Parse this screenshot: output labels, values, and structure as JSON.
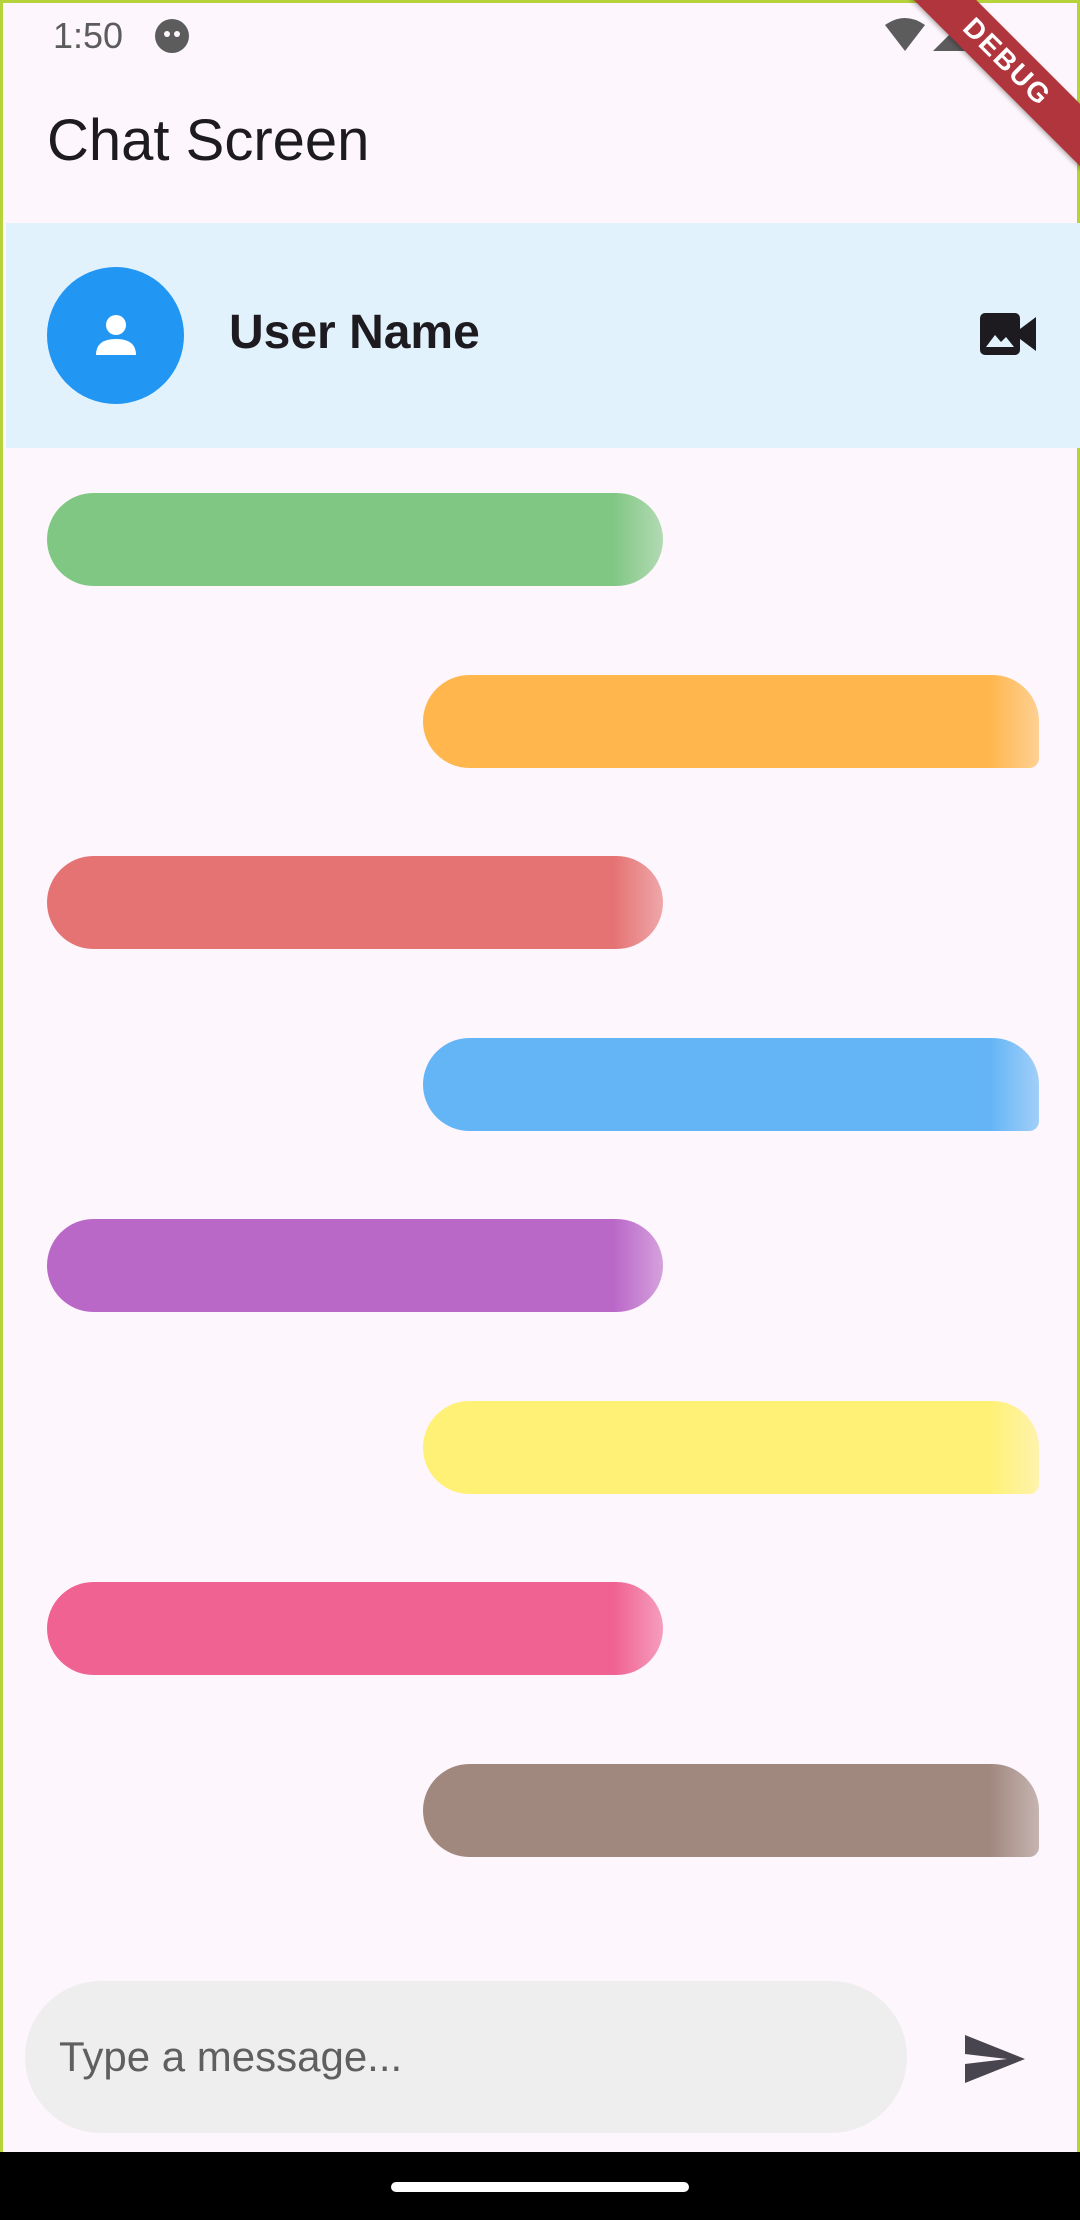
{
  "status_bar": {
    "time": "1:50"
  },
  "debug_banner": "DEBUG",
  "app_bar": {
    "title": "Chat Screen"
  },
  "chat_header": {
    "user_name": "User Name",
    "avatar_color": "#2196f3",
    "background": "#e2f2fd"
  },
  "messages": [
    {
      "side": "left",
      "color": "#81c784"
    },
    {
      "side": "right",
      "color": "#ffb74d"
    },
    {
      "side": "left",
      "color": "#e57373"
    },
    {
      "side": "right",
      "color": "#64b5f6"
    },
    {
      "side": "left",
      "color": "#ba68c8"
    },
    {
      "side": "right",
      "color": "#fff176"
    },
    {
      "side": "left",
      "color": "#f06292"
    },
    {
      "side": "right",
      "color": "#a1887f"
    }
  ],
  "composer": {
    "placeholder": "Type a message..."
  },
  "icons": {
    "avatar": "person-icon",
    "video": "video-camera-icon",
    "send": "send-icon"
  }
}
